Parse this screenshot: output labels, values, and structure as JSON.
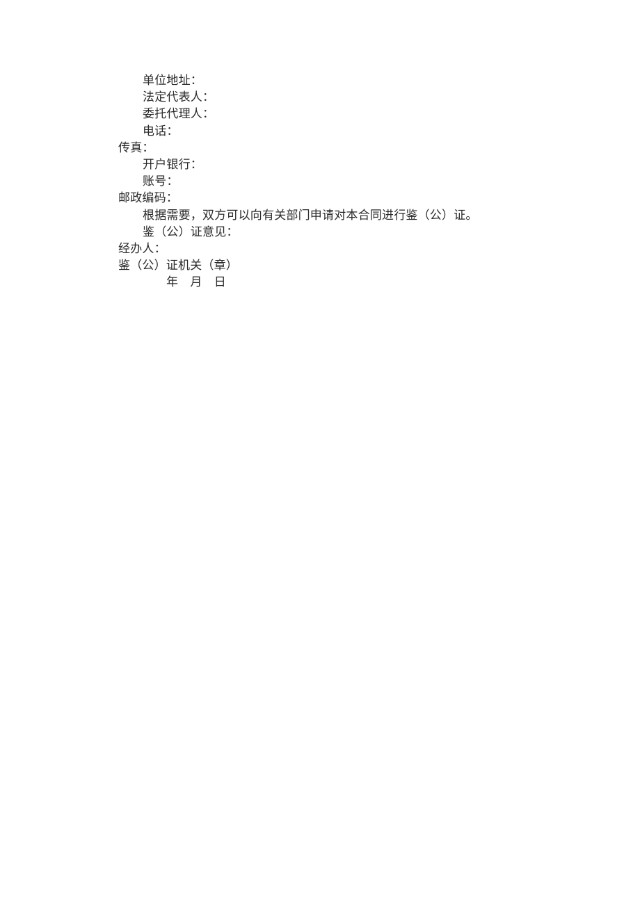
{
  "document": {
    "page_background": "#ffffff",
    "text_color": "#2a2a2a",
    "lines": [
      {
        "text": "单位地址：",
        "indent": 1
      },
      {
        "text": "法定代表人：",
        "indent": 1
      },
      {
        "text": "委托代理人：",
        "indent": 1
      },
      {
        "text": "电话：",
        "indent": 1
      },
      {
        "text": "传真：",
        "indent": 0
      },
      {
        "text": "开户银行：",
        "indent": 1
      },
      {
        "text": "账号：",
        "indent": 1
      },
      {
        "text": "邮政编码：",
        "indent": 0
      },
      {
        "text": "根据需要，双方可以向有关部门申请对本合同进行鉴（公）证。",
        "indent": 1
      },
      {
        "text": "鉴（公）证意见：",
        "indent": 1
      },
      {
        "text": "经办人：",
        "indent": 0
      },
      {
        "text": "鉴（公）证机关（章）",
        "indent": 0
      },
      {
        "text": "年　月　日",
        "indent": 2
      }
    ]
  }
}
